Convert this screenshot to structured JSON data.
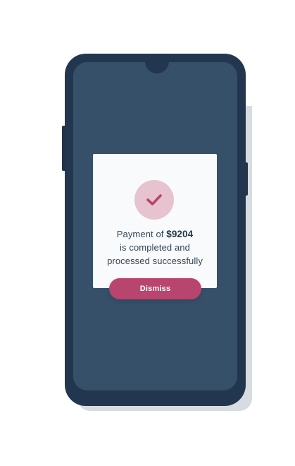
{
  "dialog": {
    "icon": "checkmark-icon",
    "message_prefix": "Payment of",
    "amount": "$9204",
    "message_line_2": "is completed and",
    "message_line_3": "processed successfully",
    "dismiss_label": "Dismiss"
  },
  "colors": {
    "phone_frame": "#22374f",
    "screen": "#365069",
    "dialog_background": "#f8fafc",
    "check_circle": "#e7c2cf",
    "accent": "#b8456d"
  }
}
